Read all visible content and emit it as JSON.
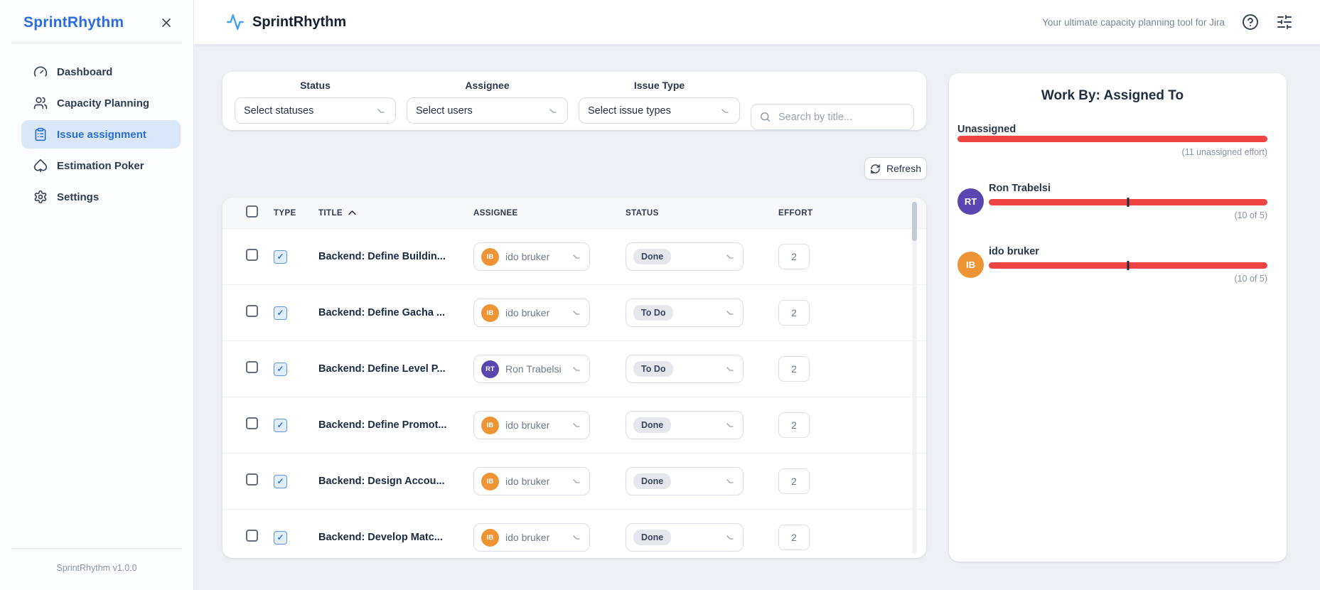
{
  "sidebar": {
    "title": "SprintRhythm",
    "version": "SprintRhythm v1.0.0",
    "items": [
      {
        "label": "Dashboard",
        "icon": "gauge-icon",
        "active": false
      },
      {
        "label": "Capacity Planning",
        "icon": "users-icon",
        "active": false
      },
      {
        "label": "Issue assignment",
        "icon": "clipboard-list-icon",
        "active": true
      },
      {
        "label": "Estimation Poker",
        "icon": "spade-icon",
        "active": false
      },
      {
        "label": "Settings",
        "icon": "gear-icon",
        "active": false
      }
    ]
  },
  "header": {
    "app_name": "SprintRhythm",
    "tagline": "Your ultimate capacity planning tool for Jira"
  },
  "filters": {
    "status": {
      "label": "Status",
      "value": "Select statuses"
    },
    "assignee": {
      "label": "Assignee",
      "value": "Select users"
    },
    "issue_type": {
      "label": "Issue Type",
      "value": "Select issue types"
    },
    "search_placeholder": "Search by title..."
  },
  "toolbar": {
    "refresh_label": "Refresh"
  },
  "table": {
    "columns": {
      "type": "TYPE",
      "title": "TITLE",
      "assignee": "ASSIGNEE",
      "status": "STATUS",
      "effort": "EFFORT"
    },
    "rows": [
      {
        "title": "Backend: Define Buildin...",
        "assignee": "ido bruker",
        "assignee_initials": "IB",
        "status": "Done",
        "effort": "2"
      },
      {
        "title": "Backend: Define Gacha ...",
        "assignee": "ido bruker",
        "assignee_initials": "IB",
        "status": "To Do",
        "effort": "2"
      },
      {
        "title": "Backend: Define Level P...",
        "assignee": "Ron Trabelsi",
        "assignee_initials": "RT",
        "status": "To Do",
        "effort": "2"
      },
      {
        "title": "Backend: Define Promot...",
        "assignee": "ido bruker",
        "assignee_initials": "IB",
        "status": "Done",
        "effort": "2"
      },
      {
        "title": "Backend: Design Accou...",
        "assignee": "ido bruker",
        "assignee_initials": "IB",
        "status": "Done",
        "effort": "2"
      },
      {
        "title": "Backend: Develop Matc...",
        "assignee": "ido bruker",
        "assignee_initials": "IB",
        "status": "Done",
        "effort": "2"
      }
    ]
  },
  "work_by": {
    "title": "Work By: Assigned To",
    "entries": [
      {
        "name": "Unassigned",
        "caption": "(11 unassigned effort)",
        "initials": null,
        "fill_pct": 100,
        "capacity_tick_pct": null
      },
      {
        "name": "Ron Trabelsi",
        "caption": "(10 of 5)",
        "initials": "RT",
        "fill_pct": 100,
        "capacity_tick_pct": 50
      },
      {
        "name": "ido bruker",
        "caption": "(10 of 5)",
        "initials": "IB",
        "fill_pct": 100,
        "capacity_tick_pct": 50
      }
    ]
  },
  "icons": {
    "logo": "activity-pulse-icon",
    "close": "close-icon",
    "help": "help-circle-icon",
    "preferences": "sliders-icon",
    "search": "search-icon",
    "refresh": "refresh-icon",
    "sort": "chevron-up-icon",
    "dropdown": "chevron-down-icon",
    "issue_type": "checked-task-icon"
  },
  "colors": {
    "brand_blue": "#2b6ce0",
    "active_nav_bg": "#d9e7f8",
    "bar_red": "#ef4444",
    "avatar_orange": "#ef9434",
    "avatar_purple": "#5a46af",
    "badge_bg": "#e5e7ec",
    "page_bg": "#eef0f5"
  }
}
